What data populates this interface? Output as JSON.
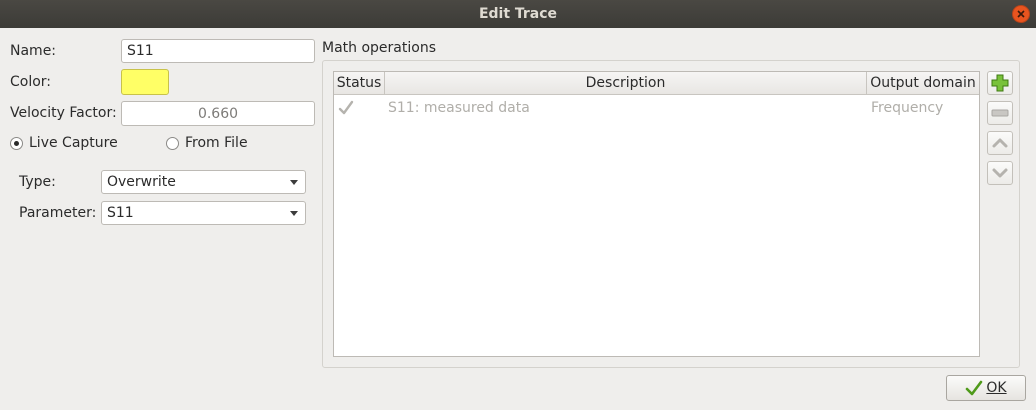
{
  "window": {
    "title": "Edit Trace"
  },
  "form": {
    "name_label": "Name:",
    "name_value": "S11",
    "color_label": "Color:",
    "color_value": "#ffff66",
    "velocity_label": "Velocity Factor:",
    "velocity_value": "0.660",
    "live_capture_label": "Live Capture",
    "live_capture_checked": true,
    "from_file_label": "From File",
    "from_file_checked": false,
    "type_label": "Type:",
    "type_value": "Overwrite",
    "parameter_label": "Parameter:",
    "parameter_value": "S11"
  },
  "math": {
    "group_title": "Math operations",
    "columns": [
      "Status",
      "Description",
      "Output domain"
    ],
    "rows": [
      {
        "status_icon": "checkmark-icon",
        "description": "S11: measured data",
        "output_domain": "Frequency"
      }
    ],
    "buttons": [
      "add-icon",
      "remove-icon",
      "move-up-icon",
      "move-down-icon"
    ]
  },
  "footer": {
    "ok_label": "OK"
  },
  "colors": {
    "titlebar": "#3c3b37",
    "close": "#e9541f",
    "add_icon": "#5aa11f"
  }
}
